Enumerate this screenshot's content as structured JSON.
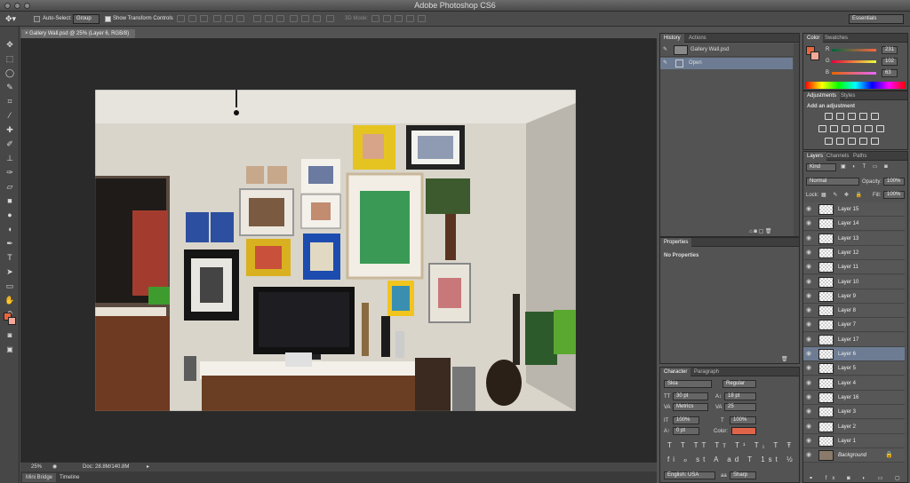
{
  "app": {
    "title": "Adobe Photoshop CS6"
  },
  "options": {
    "auto_select_label": "Auto-Select:",
    "auto_select_value": "Group",
    "show_transform": "Show Transform Controls",
    "mode3d": "3D Mode:",
    "workspace": "Essentials"
  },
  "document": {
    "tab": "Gallery Wall.psd @ 25% (Layer 6, RGB/8)",
    "zoom": "25%",
    "doc_info": "Doc: 28.8M/140.8M"
  },
  "bottom_tabs": [
    "Mini Bridge",
    "Timeline"
  ],
  "history": {
    "tabs": [
      "History",
      "Actions"
    ],
    "snapshot": "Gallery Wall.psd",
    "items": [
      "Open"
    ]
  },
  "properties": {
    "tab": "Properties",
    "text": "No Properties"
  },
  "color": {
    "tabs": [
      "Color",
      "Swatches"
    ],
    "r_label": "R",
    "g_label": "G",
    "b_label": "B",
    "r": "231",
    "g": "102",
    "b": "63",
    "fg": "#e7663f",
    "bg": "#f4a898"
  },
  "adjustments": {
    "tabs": [
      "Adjustments",
      "Styles"
    ],
    "heading": "Add an adjustment"
  },
  "layers": {
    "tabs": [
      "Layers",
      "Channels",
      "Paths"
    ],
    "kind": "Kind",
    "blend": "Normal",
    "opacity_label": "Opacity:",
    "opacity": "100%",
    "lock_label": "Lock:",
    "fill_label": "Fill:",
    "fill": "100%",
    "items": [
      "Layer 15",
      "Layer 14",
      "Layer 13",
      "Layer 12",
      "Layer 11",
      "Layer 10",
      "Layer 9",
      "Layer 8",
      "Layer 7",
      "Layer 17",
      "Layer 6",
      "Layer 5",
      "Layer 4",
      "Layer 16",
      "Layer 3",
      "Layer 2",
      "Layer 1",
      "Background"
    ],
    "selected": "Layer 6"
  },
  "character": {
    "tabs": [
      "Character",
      "Paragraph"
    ],
    "font": "Skia",
    "style": "Regular",
    "size": "30 pt",
    "leading": "18 pt",
    "kerning": "Metrics",
    "tracking": "25",
    "vscale": "100%",
    "hscale": "100%",
    "baseline": "0 pt",
    "color_label": "Color:",
    "color": "#e0644a",
    "language": "English: USA",
    "aa": "Sharp"
  }
}
